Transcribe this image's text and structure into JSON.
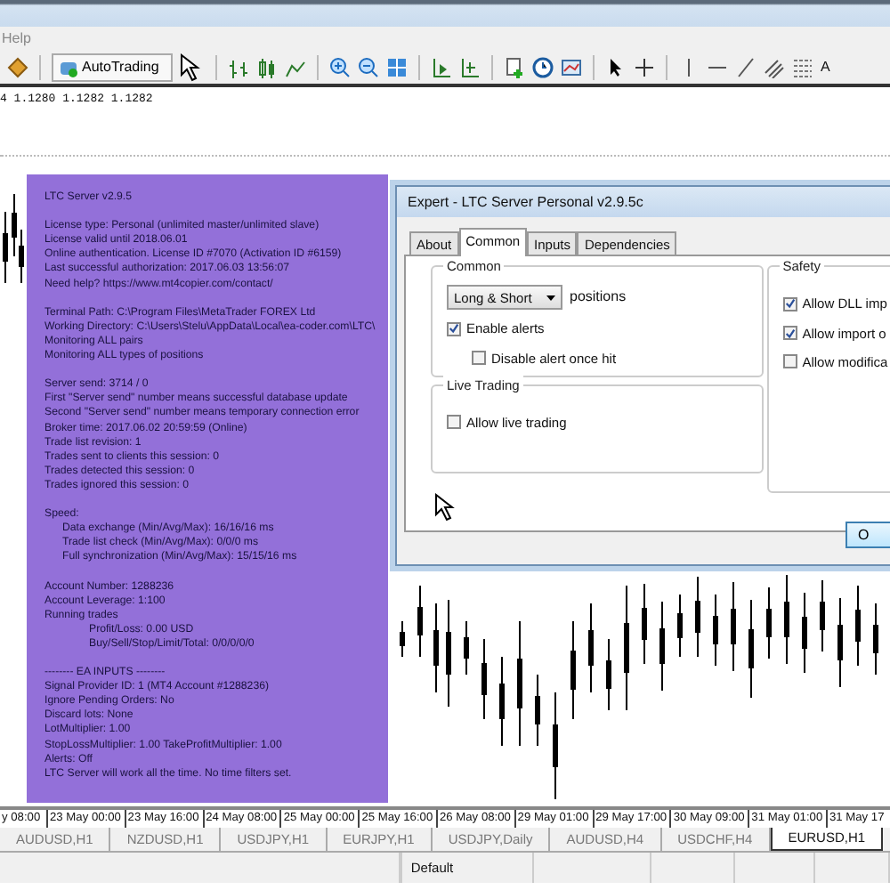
{
  "menu": [
    {
      "label": "Help"
    }
  ],
  "toolbar": {
    "autotrading": "AutoTrading",
    "text_tool": "A"
  },
  "chart": {
    "price_line": "4 1.1280 1.1282 1.1282",
    "time_axis": [
      "y 08:00",
      "23 May 00:00",
      "23 May 16:00",
      "24 May 08:00",
      "25 May 00:00",
      "25 May 16:00",
      "26 May 08:00",
      "29 May 01:00",
      "29 May 17:00",
      "30 May 09:00",
      "31 May 01:00",
      "31 May 17"
    ]
  },
  "panel": {
    "sections": [
      [
        {
          "text": "LTC Server v2.9.5",
          "kind": "plain"
        }
      ],
      [
        {
          "text": "License type: Personal (unlimited master/unlimited slave)",
          "kind": "plain"
        },
        {
          "text": "License valid until 2018.06.01",
          "kind": "plain"
        },
        {
          "text": "Online authentication. License ID #7070 (Activation ID #6159)",
          "kind": "plain"
        },
        {
          "text": "Last successful authorization: 2017.06.03 13:56:07",
          "kind": "plain"
        },
        {
          "text": "Need help? https://www.mt4copier.com/contact/",
          "kind": "plain"
        }
      ],
      [
        {
          "text": "Terminal Path: C:\\Program Files\\MetaTrader FOREX Ltd",
          "kind": "plain"
        },
        {
          "text": "Working Directory: C:\\Users\\Stelu\\AppData\\Local\\ea-coder.com\\LTC\\",
          "kind": "plain"
        },
        {
          "text": "Monitoring ALL pairs",
          "kind": "plain"
        },
        {
          "text": "Monitoring ALL types of positions",
          "kind": "plain"
        }
      ],
      [
        {
          "text": "Server send: 3714 / 0",
          "kind": "plain"
        },
        {
          "text": "First \"Server send\" number means successful database update",
          "kind": "plain"
        },
        {
          "text": "Second \"Server send\" number means temporary connection error",
          "kind": "plain"
        },
        {
          "text": "Broker time: 2017.06.02 20:59:59 (Online)",
          "kind": "plain"
        },
        {
          "text": "Trade list revision: 1",
          "kind": "plain"
        },
        {
          "text": "Trades sent to clients this session: 0",
          "kind": "plain"
        },
        {
          "text": "Trades detected this session: 0",
          "kind": "plain"
        },
        {
          "text": "Trades ignored this session: 0",
          "kind": "plain"
        }
      ],
      [
        {
          "text": "Speed:",
          "kind": "plain"
        },
        {
          "text": "Data exchange (Min/Avg/Max): 16/16/16 ms",
          "kind": "indent"
        },
        {
          "text": "Trade list check (Min/Avg/Max): 0/0/0 ms",
          "kind": "indent"
        },
        {
          "text": "Full synchronization (Min/Avg/Max): 15/15/16 ms",
          "kind": "indent"
        }
      ],
      [
        {
          "text": "Account Number: 1288236",
          "kind": "plain"
        },
        {
          "text": "Account Leverage: 1:100",
          "kind": "plain"
        },
        {
          "text": "Running trades",
          "kind": "plain"
        },
        {
          "text": "Profit/Loss: 0.00 USD",
          "kind": "indent2"
        },
        {
          "text": "Buy/Sell/Stop/Limit/Total: 0/0/0/0/0",
          "kind": "indent2"
        }
      ],
      [
        {
          "text": "-------- EA INPUTS --------",
          "kind": "plain"
        },
        {
          "text": "Signal Provider ID: 1 (MT4 Account #1288236)",
          "kind": "plain"
        },
        {
          "text": "Ignore Pending Orders: No",
          "kind": "plain"
        },
        {
          "text": "Discard lots: None",
          "kind": "plain"
        },
        {
          "text": "LotMultiplier: 1.00",
          "kind": "plain"
        },
        {
          "text": "StopLossMultiplier: 1.00      TakeProfitMultiplier: 1.00",
          "kind": "plain"
        },
        {
          "text": "Alerts: Off",
          "kind": "plain"
        },
        {
          "text": "LTC Server will work all the time. No time filters set.",
          "kind": "plain"
        }
      ]
    ]
  },
  "dialog": {
    "title": "Expert - LTC Server Personal v2.9.5c",
    "tabs": [
      {
        "label": "About",
        "selected": false
      },
      {
        "label": "Common",
        "selected": true
      },
      {
        "label": "Inputs",
        "selected": false
      },
      {
        "label": "Dependencies",
        "selected": false
      }
    ],
    "common": {
      "title": "Common",
      "direction": "Long & Short",
      "direction_suffix": "positions",
      "checkboxes": [
        {
          "label": "Enable alerts",
          "checked": true,
          "indented": false
        },
        {
          "label": "Disable alert once hit",
          "checked": false,
          "indented": true
        }
      ]
    },
    "live_trading": {
      "title": "Live Trading",
      "checkboxes": [
        {
          "label": "Allow live trading",
          "checked": false
        }
      ]
    },
    "safety": {
      "title": "Safety",
      "checkboxes": [
        {
          "label": "Allow DLL imp",
          "checked": true
        },
        {
          "label": "Allow import o",
          "checked": true
        },
        {
          "label": "Allow modifica",
          "checked": false
        }
      ]
    },
    "ok_button": "O"
  },
  "symbol_tabs": [
    {
      "label": "AUDUSD,H1",
      "selected": false
    },
    {
      "label": "NZDUSD,H1",
      "selected": false
    },
    {
      "label": "USDJPY,H1",
      "selected": false
    },
    {
      "label": "EURJPY,H1",
      "selected": false
    },
    {
      "label": "USDJPY,Daily",
      "selected": false
    },
    {
      "label": "AUDUSD,H4",
      "selected": false
    },
    {
      "label": "USDCHF,H4",
      "selected": false
    },
    {
      "label": "EURUSD,H1",
      "selected": true
    }
  ],
  "status_bar": {
    "profile": "Default"
  }
}
